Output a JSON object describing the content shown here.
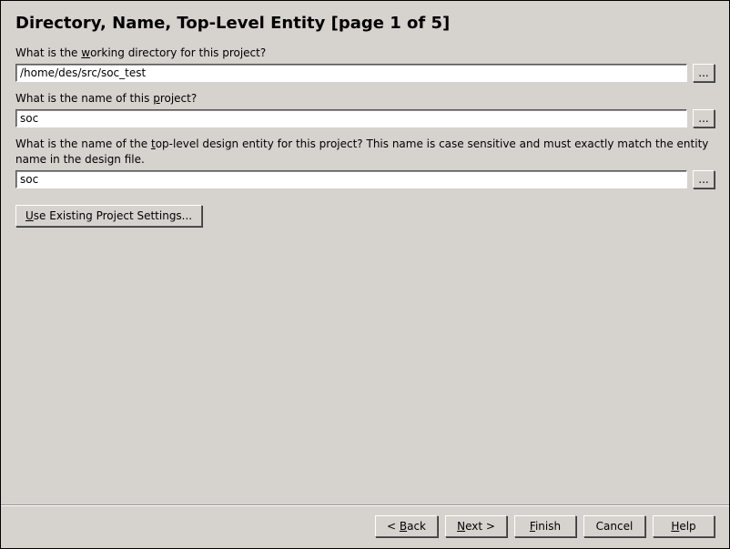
{
  "title": "Directory, Name, Top-Level Entity [page 1 of 5]",
  "fields": {
    "workdir": {
      "label_pre": "What is the ",
      "label_mn": "w",
      "label_post": "orking directory for this project?",
      "value": "/home/des/src/soc_test",
      "browse": "..."
    },
    "projname": {
      "label_pre": "What is the name of this ",
      "label_mn": "p",
      "label_post": "roject?",
      "value": "soc",
      "browse": "..."
    },
    "toplevel": {
      "label_pre": "What is the name of the ",
      "label_mn": "t",
      "label_post": "op-level design entity for this project? This name is case sensitive and must exactly match the entity name in the design file.",
      "value": "soc",
      "browse": "..."
    }
  },
  "settings_btn": {
    "mn": "U",
    "rest": "se Existing Project Settings..."
  },
  "footer": {
    "back": {
      "pre": "< ",
      "mn": "B",
      "post": "ack"
    },
    "next": {
      "pre": "",
      "mn": "N",
      "post": "ext >"
    },
    "finish": {
      "pre": "",
      "mn": "F",
      "post": "inish"
    },
    "cancel": {
      "pre": "Cancel",
      "mn": "",
      "post": ""
    },
    "help": {
      "pre": "",
      "mn": "H",
      "post": "elp"
    }
  }
}
